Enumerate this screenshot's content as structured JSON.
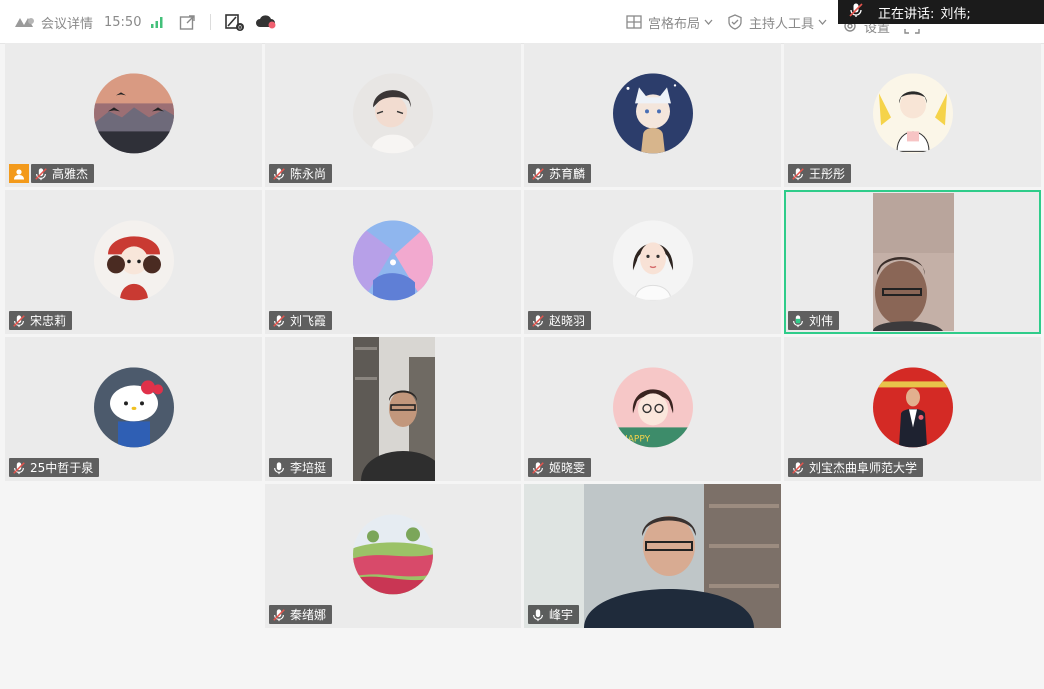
{
  "topbar": {
    "meeting_details_label": "会议详情",
    "time": "15:50",
    "layout_label": "宫格布局",
    "host_tools_label": "主持人工具",
    "settings_label": "设置",
    "speaking_label": "正在讲话:",
    "speaking_name": "刘伟;",
    "icons": [
      "meeting-logo-icon",
      "signal-icon",
      "share-out-icon",
      "mic-stats-icon",
      "cloud-record-icon",
      "grid-layout-icon",
      "shield-icon",
      "chevron-down-icon",
      "gear-icon",
      "fullscreen-icon"
    ]
  },
  "colors": {
    "active_border": "#2fcc8a",
    "host_badge": "#f39a1b",
    "tag_bg": "#282828"
  },
  "participants": [
    {
      "name": "高雅杰",
      "mic": "muted",
      "host": true,
      "media": "avatar",
      "avatar": "sunset-birds"
    },
    {
      "name": "陈永尚",
      "mic": "muted",
      "media": "avatar",
      "avatar": "anime-boy"
    },
    {
      "name": "苏育麟",
      "mic": "muted",
      "media": "avatar",
      "avatar": "anime-cat-boy"
    },
    {
      "name": "王彤彤",
      "mic": "muted",
      "media": "avatar",
      "avatar": "cartoon-girl"
    },
    {
      "name": "宋忠莉",
      "mic": "muted",
      "media": "avatar",
      "avatar": "red-hat-girl"
    },
    {
      "name": "刘飞霞",
      "mic": "muted",
      "media": "avatar",
      "avatar": "pastel-sky"
    },
    {
      "name": "赵晓羽",
      "mic": "muted",
      "media": "avatar",
      "avatar": "young-woman"
    },
    {
      "name": "刘伟",
      "mic": "speaking",
      "media": "video",
      "active": true
    },
    {
      "name": "25中哲于泉",
      "mic": "muted",
      "media": "avatar",
      "avatar": "hello-kitty"
    },
    {
      "name": "李培挺",
      "mic": "on",
      "media": "video"
    },
    {
      "name": "姬晓雯",
      "mic": "muted",
      "media": "avatar",
      "avatar": "glasses-girl"
    },
    {
      "name": "刘宝杰曲阜师范大学",
      "mic": "muted",
      "media": "avatar",
      "avatar": "man-red-backdrop"
    },
    {
      "name": "秦绪娜",
      "mic": "muted",
      "media": "avatar",
      "avatar": "tulip-field"
    },
    {
      "name": "峰宇",
      "mic": "on",
      "media": "video"
    }
  ]
}
